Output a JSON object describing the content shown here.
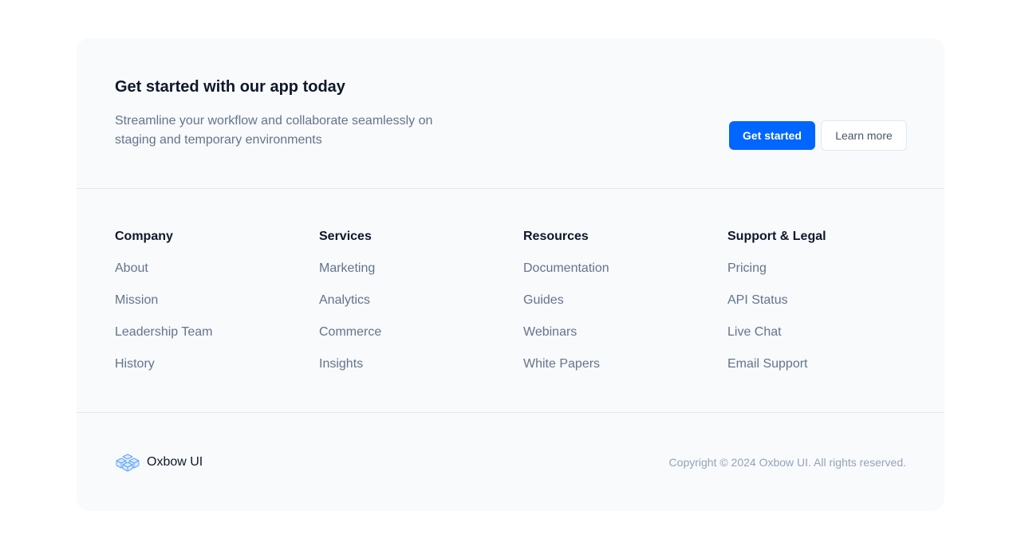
{
  "cta": {
    "title": "Get started with our app today",
    "description": "Streamline your workflow and collaborate seamlessly on staging and temporary environments",
    "primary_label": "Get started",
    "secondary_label": "Learn more"
  },
  "columns": [
    {
      "heading": "Company",
      "links": [
        "About",
        "Mission",
        "Leadership Team",
        "History"
      ]
    },
    {
      "heading": "Services",
      "links": [
        "Marketing",
        "Analytics",
        "Commerce",
        "Insights"
      ]
    },
    {
      "heading": "Resources",
      "links": [
        "Documentation",
        "Guides",
        "Webinars",
        "White Papers"
      ]
    },
    {
      "heading": "Support & Legal",
      "links": [
        "Pricing",
        "API Status",
        "Live Chat",
        "Email Support"
      ]
    }
  ],
  "footer": {
    "brand_name": "Oxbow UI",
    "logo_icon": "cube-cluster-icon",
    "copyright": "Copyright © 2024 Oxbow UI. All rights reserved."
  },
  "colors": {
    "accent": "#0066ff",
    "card_background": "#f8fafc",
    "heading": "#0f172a",
    "muted_text": "#64748b",
    "logo": "#60a5fa"
  }
}
